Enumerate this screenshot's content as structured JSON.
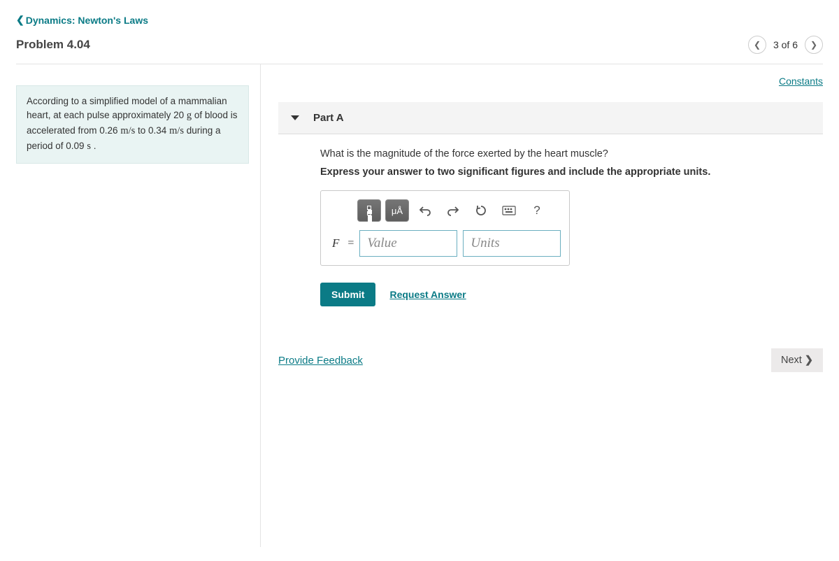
{
  "header": {
    "back": "Dynamics: Newton's Laws",
    "title": "Problem 4.04",
    "position": "3 of 6"
  },
  "problem": {
    "text_1": "According to a simplified model of a mammalian heart, at each pulse approximately 20",
    "u1": "g",
    "text_2": " of blood is accelerated from 0.26 ",
    "u2": "m/s",
    "text_3": " to 0.34 ",
    "u3": "m/s",
    "text_4": " during a period of 0.09 ",
    "u4": "s",
    "text_5": " ."
  },
  "links": {
    "constants": "Constants",
    "feedback": "Provide Feedback",
    "request": "Request Answer"
  },
  "part": {
    "label": "Part A",
    "question": "What is the magnitude of the force exerted by the heart muscle?",
    "instruction": "Express your answer to two significant figures and include the appropriate units."
  },
  "inputs": {
    "var": "F",
    "eq": "=",
    "value_ph": "Value",
    "units_ph": "Units"
  },
  "toolbar": {
    "mu": "μÅ",
    "help": "?"
  },
  "buttons": {
    "submit": "Submit",
    "next": "Next"
  }
}
